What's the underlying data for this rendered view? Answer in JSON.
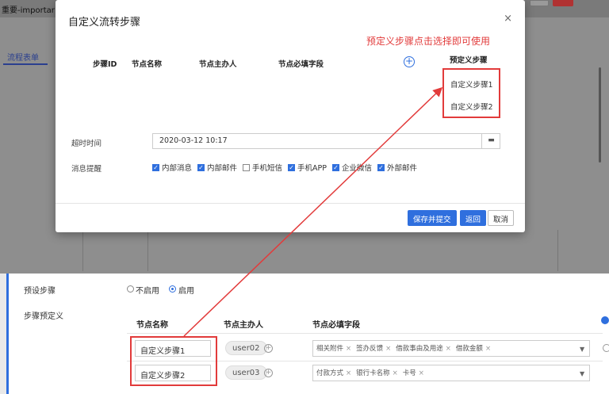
{
  "background": {
    "tab_text": "重要-importar",
    "sidebar_tab": "流程表单",
    "preset_steps_label": "预设步骤",
    "radio_disable": "不启用",
    "radio_enable": "启用",
    "step_predef_label": "步骤预定义",
    "columns": [
      "节点名称",
      "节点主办人",
      "节点必填字段"
    ],
    "rows": [
      {
        "name": "自定义步骤1",
        "user": "user02",
        "tags": [
          "相关附件",
          "签办反馈",
          "借款事由及用途",
          "借款金额"
        ]
      },
      {
        "name": "自定义步骤2",
        "user": "user03",
        "tags": [
          "付款方式",
          "银行卡名称",
          "卡号"
        ]
      }
    ]
  },
  "modal": {
    "title": "自定义流转步骤",
    "close": "×",
    "hint": "预定义步骤点击选择即可使用",
    "columns": {
      "step_id": "步骤ID",
      "node_name": "节点名称",
      "node_owner": "节点主办人",
      "required_fields": "节点必填字段",
      "predef": "预定义步骤"
    },
    "add_icon": "+",
    "predef_items": [
      "自定义步骤1",
      "自定义步骤2"
    ],
    "timeout_label": "超时时间",
    "timeout_value": "2020-03-12 10:17",
    "calendar_icon": "▬",
    "remind_label": "消息提醒",
    "remind_options": [
      {
        "label": "内部消息",
        "checked": true
      },
      {
        "label": "内部邮件",
        "checked": true
      },
      {
        "label": "手机短信",
        "checked": false
      },
      {
        "label": "手机APP",
        "checked": true
      },
      {
        "label": "企业微信",
        "checked": true
      },
      {
        "label": "外部邮件",
        "checked": true
      }
    ],
    "buttons": {
      "save_submit": "保存并提交",
      "back": "返回",
      "cancel": "取消"
    }
  },
  "colors": {
    "accent": "#2f6fde",
    "annotation": "#e23b3b"
  }
}
